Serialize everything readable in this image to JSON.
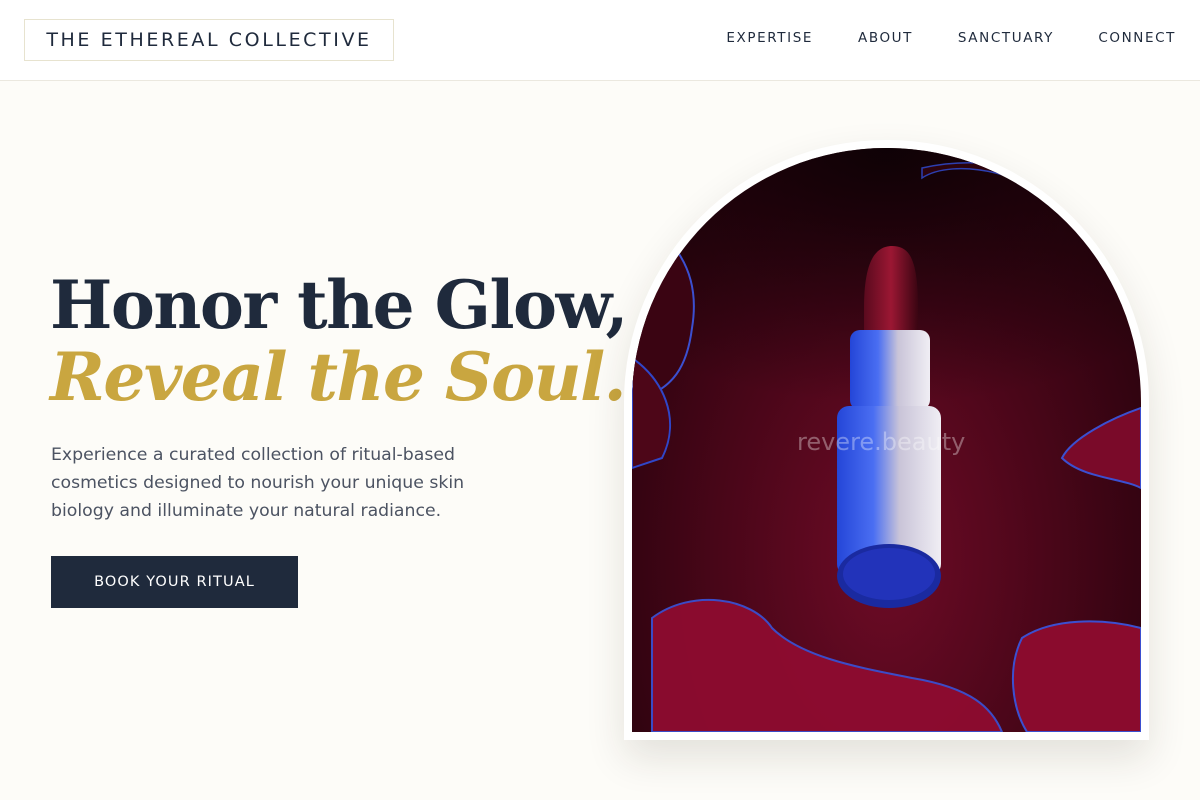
{
  "header": {
    "brand": "THE ETHEREAL COLLECTIVE",
    "nav": [
      "EXPERTISE",
      "ABOUT",
      "SANCTUARY",
      "CONNECT"
    ]
  },
  "hero": {
    "headline": "Honor the Glow,",
    "subheadline": "Reveal the Soul.",
    "description": "Experience a curated collection of ritual-based cosmetics designed to nourish your unique skin biology and illuminate your natural radiance.",
    "cta_label": "BOOK YOUR RITUAL"
  },
  "image": {
    "watermark": "revere.beauty",
    "subject": "lipstick-on-red-gloss"
  },
  "colors": {
    "navy": "#1f2a3c",
    "gold": "#c9a640",
    "background": "#fdfcf8",
    "wine": "#6e0b26"
  }
}
